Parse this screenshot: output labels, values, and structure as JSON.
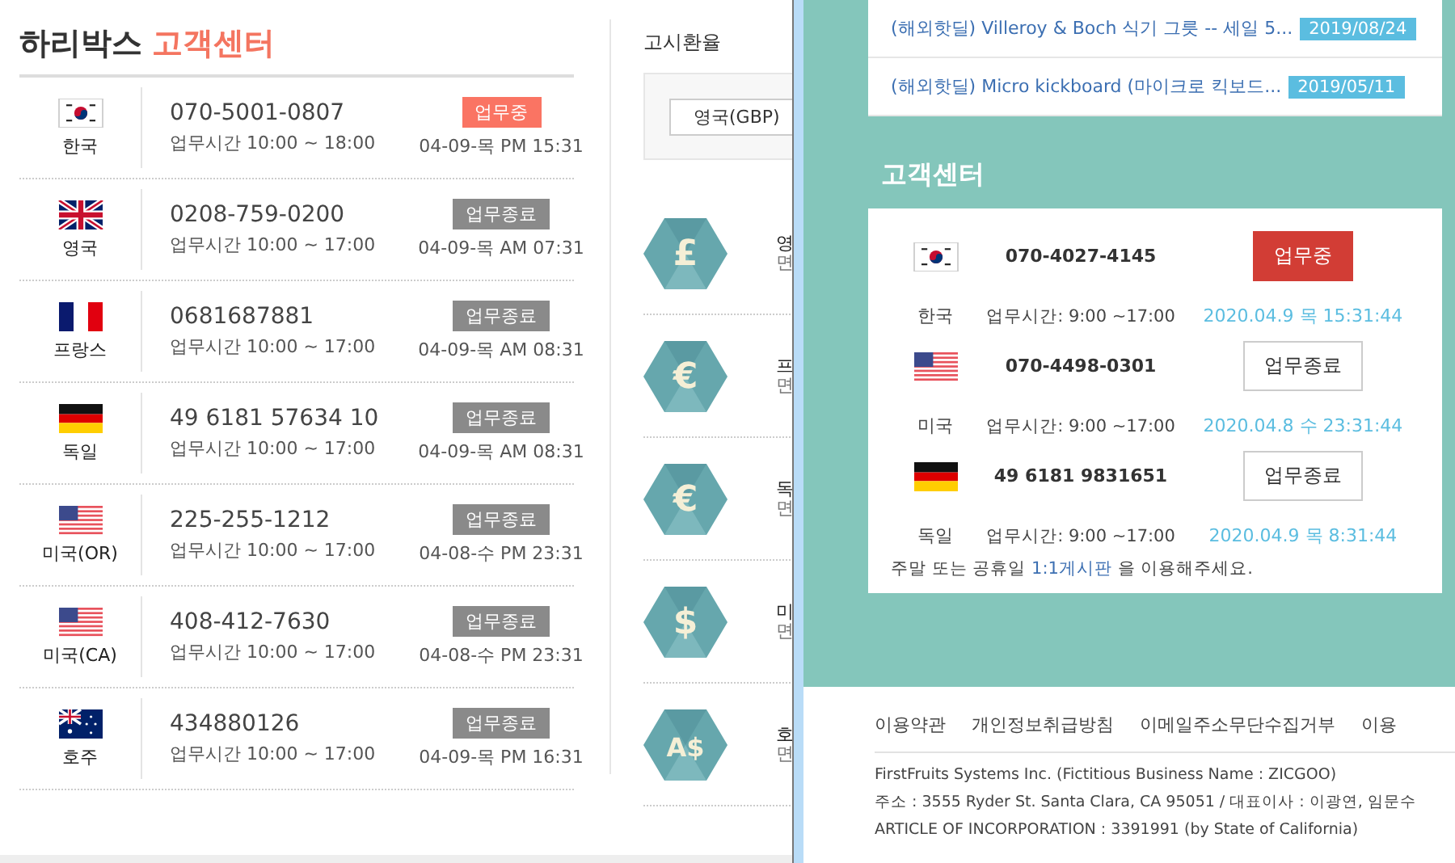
{
  "left_page": {
    "title": {
      "brand": "하리박스",
      "section": "고객센터"
    },
    "centers": [
      {
        "kind": "korea",
        "country": "한국",
        "phone": "070-5001-0807",
        "hours": "업무시간 10:00 ~ 18:00",
        "status": "업무중",
        "working": true,
        "time": "04-09-목 PM 15:31"
      },
      {
        "kind": "uk",
        "country": "영국",
        "phone": "0208-759-0200",
        "hours": "업무시간 10:00 ~ 17:00",
        "status": "업무종료",
        "working": false,
        "time": "04-09-목 AM 07:31"
      },
      {
        "kind": "france",
        "country": "프랑스",
        "phone": "0681687881",
        "hours": "업무시간 10:00 ~ 17:00",
        "status": "업무종료",
        "working": false,
        "time": "04-09-목 AM 08:31"
      },
      {
        "kind": "germany",
        "country": "독일",
        "phone": "49 6181 57634 10",
        "hours": "업무시간 10:00 ~ 17:00",
        "status": "업무종료",
        "working": false,
        "time": "04-09-목 AM 08:31"
      },
      {
        "kind": "usa",
        "country": "미국(OR)",
        "phone": "225-255-1212",
        "hours": "업무시간 10:00 ~ 17:00",
        "status": "업무종료",
        "working": false,
        "time": "04-08-수 PM 23:31"
      },
      {
        "kind": "usa",
        "country": "미국(CA)",
        "phone": "408-412-7630",
        "hours": "업무시간 10:00 ~ 17:00",
        "status": "업무종료",
        "working": false,
        "time": "04-08-수 PM 23:31"
      },
      {
        "kind": "australia",
        "country": "호주",
        "phone": "434880126",
        "hours": "업무시간 10:00 ~ 17:00",
        "status": "업무종료",
        "working": false,
        "time": "04-09-목 PM 16:31"
      }
    ],
    "exchange": {
      "title": "고시환율",
      "select_value": "영국(GBP)",
      "items": [
        {
          "symbol": "£",
          "name": "영",
          "note": "면"
        },
        {
          "symbol": "€",
          "name": "프",
          "note": "면"
        },
        {
          "symbol": "€",
          "name": "독",
          "note": "면"
        },
        {
          "symbol": "$",
          "name": "미",
          "note": "면"
        },
        {
          "symbol": "A$",
          "name": "호",
          "note": "면"
        }
      ]
    }
  },
  "right_window": {
    "deals": [
      {
        "title": "(해외핫딜) Villeroy & Boch 식기 그릇 -- 세일 5...",
        "date": "2019/08/24"
      },
      {
        "title": "(해외핫딜) Micro kickboard (마이크로 킥보드...",
        "date": "2019/05/11"
      }
    ],
    "center_title": "고객센터",
    "centers": [
      {
        "kind": "korea",
        "country": "한국",
        "phone": "070-4027-4145",
        "hours": "업무시간: 9:00 ~17:00",
        "status": "업무중",
        "working": true,
        "time": "2020.04.9 목 15:31:44"
      },
      {
        "kind": "usa",
        "country": "미국",
        "phone": "070-4498-0301",
        "hours": "업무시간: 9:00 ~17:00",
        "status": "업무종료",
        "working": false,
        "time": "2020.04.8 수 23:31:44"
      },
      {
        "kind": "germany",
        "country": "독일",
        "phone": "49 6181 9831651",
        "hours": "업무시간: 9:00 ~17:00",
        "status": "업무종료",
        "working": false,
        "time": "2020.04.9 목 8:31:44"
      }
    ],
    "notice": {
      "before": "주말 또는 공휴일",
      "link": "1:1게시판",
      "after": "을 이용해주세요."
    },
    "footer_links": [
      "이용약관",
      "개인정보취급방침",
      "이메일주소무단수집거부",
      "이용"
    ],
    "company_lines": [
      "FirstFruits Systems Inc. (Fictitious Business Name : ZICGOO)",
      "주소 : 3555 Ryder St. Santa Clara, CA 95051 / 대표이사 : 이광연, 임문수",
      "ARTICLE OF INCORPORATION : 3391991 (by State of California)"
    ]
  }
}
